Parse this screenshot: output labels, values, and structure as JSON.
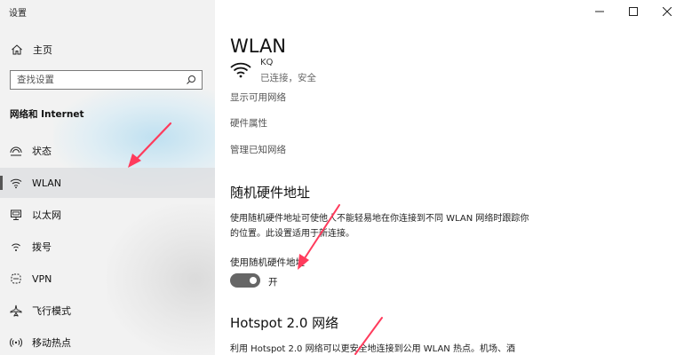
{
  "window": {
    "title": "设置",
    "controls": [
      "minimize",
      "maximize",
      "close"
    ]
  },
  "sidebar": {
    "home_label": "主页",
    "search_placeholder": "查找设置",
    "section_title": "网络和 Internet",
    "items": [
      {
        "label": "状态",
        "icon": "status-icon"
      },
      {
        "label": "WLAN",
        "icon": "wifi-icon",
        "selected": true
      },
      {
        "label": "以太网",
        "icon": "ethernet-icon"
      },
      {
        "label": "拨号",
        "icon": "dialup-icon"
      },
      {
        "label": "VPN",
        "icon": "vpn-icon"
      },
      {
        "label": "飞行模式",
        "icon": "airplane-icon"
      },
      {
        "label": "移动热点",
        "icon": "hotspot-icon"
      }
    ]
  },
  "main": {
    "title": "WLAN",
    "network": {
      "name": "KQ",
      "status": "已连接，安全"
    },
    "links": [
      "显示可用网络",
      "硬件属性",
      "管理已知网络"
    ],
    "random_hw": {
      "heading": "随机硬件地址",
      "description": "使用随机硬件地址可使他人不能轻易地在你连接到不同 WLAN 网络时跟踪你的位置。此设置适用于新连接。",
      "toggle_label": "使用随机硬件地址",
      "toggle_state": "开",
      "toggle_on": true
    },
    "hotspot": {
      "heading": "Hotspot 2.0 网络",
      "description": "利用 Hotspot 2.0 网络可以更安全地连接到公用 WLAN 热点。机场、酒"
    }
  },
  "colors": {
    "sidebar_bg": "#f2f2f2",
    "toggle_on": "#666666",
    "annotation_arrow": "#ff3b5c"
  }
}
